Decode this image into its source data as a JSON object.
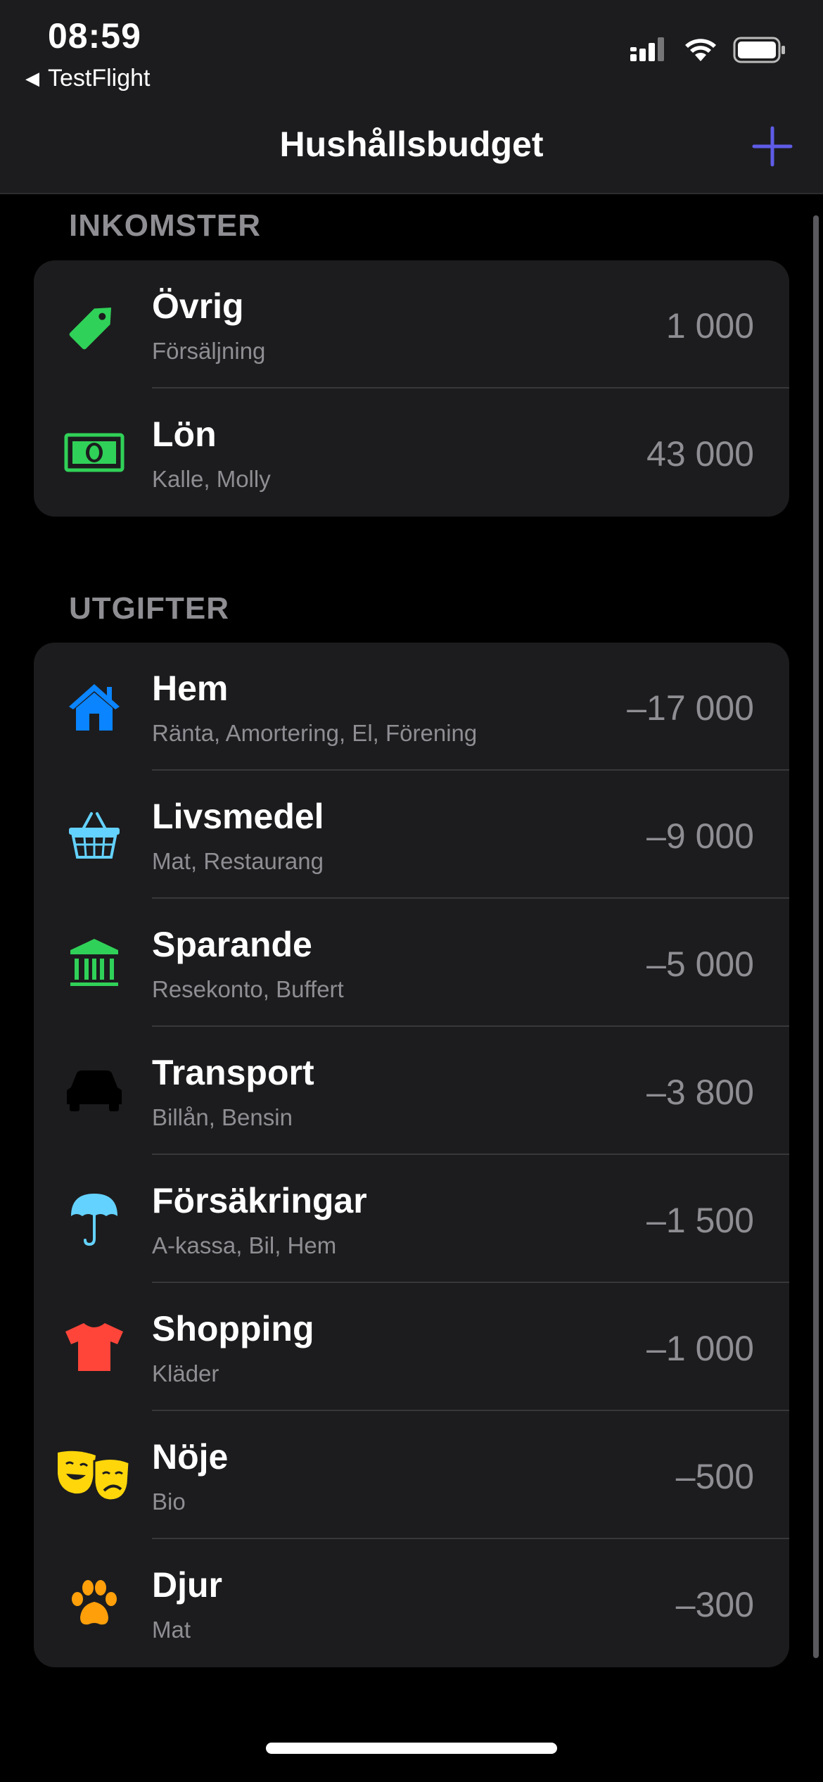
{
  "status_bar": {
    "time": "08:59",
    "back_app": "TestFlight",
    "icons": [
      "cellular-signal-icon",
      "wifi-icon",
      "battery-icon"
    ]
  },
  "nav": {
    "title": "Hushållsbudget",
    "add_icon": "plus-icon",
    "accent": "#5e5ce6"
  },
  "income": {
    "header": "INKOMSTER",
    "items": [
      {
        "title": "Övrig",
        "subtitle": "Försäljning",
        "amount": "1 000",
        "icon": "tag-icon",
        "color": "#30d158"
      },
      {
        "title": "Lön",
        "subtitle": "Kalle, Molly",
        "amount": "43 000",
        "icon": "banknote-icon",
        "color": "#30d158"
      }
    ]
  },
  "expenses": {
    "header": "UTGIFTER",
    "items": [
      {
        "title": "Hem",
        "subtitle": "Ränta, Amortering, El, Förening",
        "amount": "–17 000",
        "icon": "house-icon",
        "color": "#0a84ff"
      },
      {
        "title": "Livsmedel",
        "subtitle": "Mat, Restaurang",
        "amount": "–9 000",
        "icon": "basket-icon",
        "color": "#64d2ff"
      },
      {
        "title": "Sparande",
        "subtitle": "Resekonto, Buffert",
        "amount": "–5 000",
        "icon": "bank-icon",
        "color": "#30d158"
      },
      {
        "title": "Transport",
        "subtitle": "Billån, Bensin",
        "amount": "–3 800",
        "icon": "car-icon",
        "color": "#000000"
      },
      {
        "title": "Försäkringar",
        "subtitle": "A-kassa, Bil, Hem",
        "amount": "–1 500",
        "icon": "umbrella-icon",
        "color": "#64d2ff"
      },
      {
        "title": "Shopping",
        "subtitle": "Kläder",
        "amount": "–1 000",
        "icon": "tshirt-icon",
        "color": "#ff453a"
      },
      {
        "title": "Nöje",
        "subtitle": "Bio",
        "amount": "–500",
        "icon": "theater-masks-icon",
        "color": "#ffd60a"
      },
      {
        "title": "Djur",
        "subtitle": "Mat",
        "amount": "–300",
        "icon": "pawprint-icon",
        "color": "#ff9f0a"
      }
    ]
  }
}
